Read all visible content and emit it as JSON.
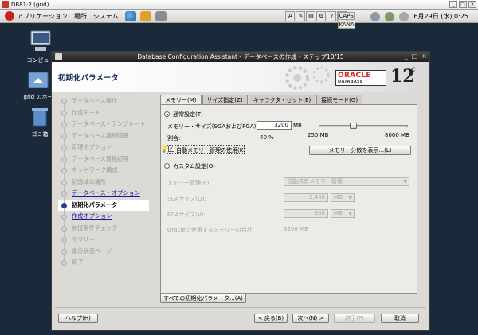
{
  "vnc": {
    "title": "DB81:2 (grid)"
  },
  "panel": {
    "menus": [
      "アプリケーション",
      "場所",
      "システム"
    ],
    "tray_caps_label": "CAPS",
    "tray_kana_label": "KANA",
    "datetime": "6月29日 (水)  0:25",
    "user": "grid"
  },
  "desktop": {
    "icons": [
      {
        "label": "コンピュー",
        "icon": "computer-icon"
      },
      {
        "label": "grid のホー",
        "icon": "home-folder-icon"
      },
      {
        "label": "ゴミ箱",
        "icon": "trash-icon"
      }
    ]
  },
  "window": {
    "title": "Database Configuration Assistant - データベースの作成 - ステップ10/15",
    "banner_title": "初期化パラメータ",
    "brand": {
      "oracle": "ORACLE",
      "database": "DATABASE",
      "version": "12",
      "version_suffix": "c"
    }
  },
  "steps": [
    {
      "label": "データベース操作",
      "state": "disabled"
    },
    {
      "label": "作成モード",
      "state": "disabled"
    },
    {
      "label": "データベース・テンプレート",
      "state": "disabled"
    },
    {
      "label": "データベース識別情報",
      "state": "disabled"
    },
    {
      "label": "管理オプション",
      "state": "disabled"
    },
    {
      "label": "データベース資格証明",
      "state": "disabled"
    },
    {
      "label": "ネットワーク構成",
      "state": "disabled"
    },
    {
      "label": "記憶域の場所",
      "state": "disabled"
    },
    {
      "label": "データベース・オプション",
      "state": "link"
    },
    {
      "label": "初期化パラメータ",
      "state": "current"
    },
    {
      "label": "作成オプション",
      "state": "link"
    },
    {
      "label": "前提条件チェック",
      "state": "disabled"
    },
    {
      "label": "サマリー",
      "state": "disabled"
    },
    {
      "label": "進行状況ページ",
      "state": "disabled"
    },
    {
      "label": "終了",
      "state": "disabled"
    }
  ],
  "tabs": [
    {
      "label": "メモリー(M)",
      "active": true
    },
    {
      "label": "サイズ指定(Z)",
      "active": false
    },
    {
      "label": "キャラクタ・セット(E)",
      "active": false
    },
    {
      "label": "接続モード(G)",
      "active": false
    }
  ],
  "memory": {
    "typical_label": "通常設定(T)",
    "memory_size_label": "メモリー・サイズ(SGAおよびPGA)(I):",
    "memory_size_value": "3200",
    "memory_size_unit": "MB",
    "percent_label": "割合:",
    "percent_value": "40 %",
    "slider_min_label": "250 MB",
    "slider_max_label": "8000 MB",
    "slider_fraction": 0.38,
    "amm_label": "自動メモリー管理の使用(K)",
    "amm_checked": true,
    "show_distribution_button": "メモリー分散を表示...(L)",
    "custom_label": "カスタム設定(O)",
    "custom_selected": false,
    "typical_selected": true,
    "mgmt_label": "メモリー管理(R):",
    "mgmt_value": "自動共有メモリー管理",
    "sga_label": "SGAサイズ(Q):",
    "sga_value": "2,400",
    "sga_unit": "MB",
    "pga_label": "PGAサイズ(V):",
    "pga_value": "800",
    "pga_unit": "MB",
    "total_label": "Oracleで使用するメモリーの合計:",
    "total_value": "3200 MB"
  },
  "buttons": {
    "all_params": "すべての初期化パラメータ...(A)",
    "help": "ヘルプ(H)",
    "back": "< 戻る(B)",
    "next": "次へ(N) >",
    "finish": "終了(F)",
    "cancel": "取消"
  },
  "colors": {
    "current_step": "#243f8a",
    "oracle_red": "#e2231a"
  }
}
